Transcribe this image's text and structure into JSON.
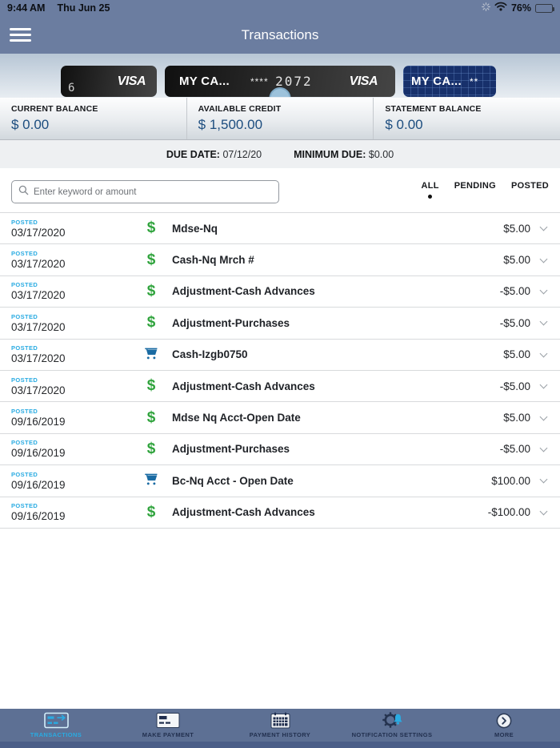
{
  "status_bar": {
    "time": "9:44 AM",
    "date": "Thu Jun 25",
    "battery_percent": "76%"
  },
  "header": {
    "title": "Transactions"
  },
  "card_carousel": {
    "cards": [
      {
        "visible_text": "6",
        "brand": "VISA"
      },
      {
        "name": "MY CA...",
        "masked_stars": "****",
        "masked_last4": "2072",
        "brand": "VISA"
      },
      {
        "name": "MY CA...",
        "masked_stars": "**"
      }
    ]
  },
  "account_summary": {
    "current_balance_label": "CURRENT BALANCE",
    "current_balance": "$ 0.00",
    "available_credit_label": "AVAILABLE CREDIT",
    "available_credit": "$ 1,500.00",
    "statement_balance_label": "STATEMENT BALANCE",
    "statement_balance": "$ 0.00"
  },
  "due_bar": {
    "due_date_label": "DUE DATE:",
    "due_date_value": "07/12/20",
    "minimum_due_label": "MINIMUM DUE:",
    "minimum_due_value": "$0.00"
  },
  "search": {
    "placeholder": "Enter keyword or amount"
  },
  "filters": {
    "all": "ALL",
    "pending": "PENDING",
    "posted": "POSTED",
    "active": "ALL"
  },
  "transactions": [
    {
      "status": "POSTED",
      "date": "03/17/2020",
      "icon": "dollar",
      "name": "Mdse-Nq",
      "amount": "$5.00"
    },
    {
      "status": "POSTED",
      "date": "03/17/2020",
      "icon": "dollar",
      "name": "Cash-Nq Mrch #",
      "amount": "$5.00"
    },
    {
      "status": "POSTED",
      "date": "03/17/2020",
      "icon": "dollar",
      "name": "Adjustment-Cash Advances",
      "amount": "-$5.00"
    },
    {
      "status": "POSTED",
      "date": "03/17/2020",
      "icon": "dollar",
      "name": "Adjustment-Purchases",
      "amount": "-$5.00"
    },
    {
      "status": "POSTED",
      "date": "03/17/2020",
      "icon": "cart",
      "name": "Cash-Izgb0750",
      "amount": "$5.00"
    },
    {
      "status": "POSTED",
      "date": "03/17/2020",
      "icon": "dollar",
      "name": "Adjustment-Cash Advances",
      "amount": "-$5.00"
    },
    {
      "status": "POSTED",
      "date": "09/16/2019",
      "icon": "dollar",
      "name": "Mdse Nq Acct-Open Date",
      "amount": "$5.00"
    },
    {
      "status": "POSTED",
      "date": "09/16/2019",
      "icon": "dollar",
      "name": "Adjustment-Purchases",
      "amount": "-$5.00"
    },
    {
      "status": "POSTED",
      "date": "09/16/2019",
      "icon": "cart",
      "name": "Bc-Nq Acct - Open Date",
      "amount": "$100.00"
    },
    {
      "status": "POSTED",
      "date": "09/16/2019",
      "icon": "dollar",
      "name": "Adjustment-Cash Advances",
      "amount": "-$100.00"
    }
  ],
  "bottom_nav": {
    "items": [
      {
        "label": "TRANSACTIONS",
        "active": true
      },
      {
        "label": "MAKE PAYMENT",
        "active": false
      },
      {
        "label": "PAYMENT HISTORY",
        "active": false
      },
      {
        "label": "NOTIFICATION SETTINGS",
        "active": false
      },
      {
        "label": "MORE",
        "active": false
      }
    ]
  },
  "colors": {
    "accent_cyan": "#29abe2",
    "positive_green": "#2fa33c",
    "cart_blue": "#1a6ba3",
    "value_navy": "#1c4d7f",
    "header_bg": "#6b7da0",
    "nav_bg": "#5d7094"
  }
}
